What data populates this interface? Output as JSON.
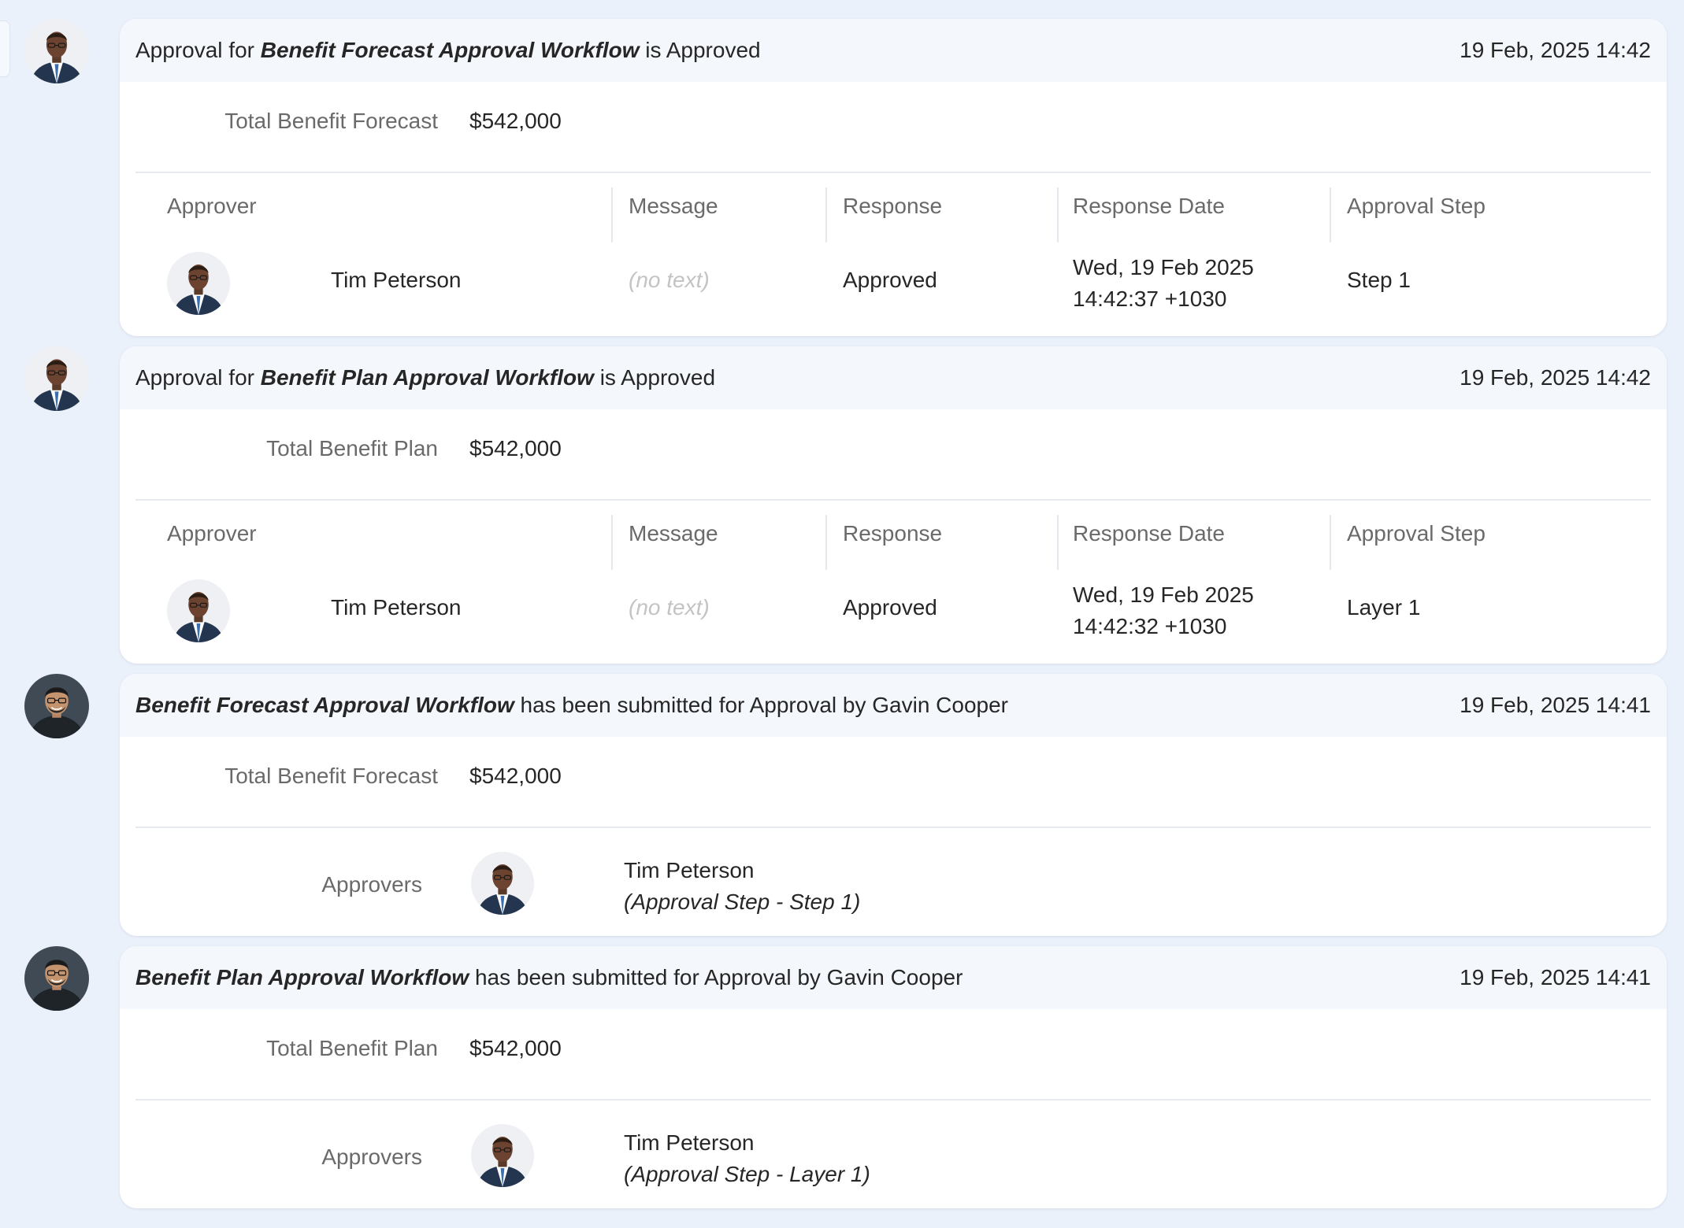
{
  "entries": [
    {
      "actor": "Tim Peterson",
      "header": {
        "prefix": "Approval for ",
        "workflow": "Benefit Forecast Approval Workflow",
        "suffix": " is Approved",
        "timestamp": "19 Feb, 2025 14:42"
      },
      "summary": {
        "label": "Total Benefit Forecast",
        "value": "$542,000"
      },
      "columns": [
        "Approver",
        "Message",
        "Response",
        "Response Date",
        "Approval Step"
      ],
      "row": {
        "approver": "Tim Peterson",
        "message": "(no text)",
        "response": "Approved",
        "date_line1": "Wed, 19 Feb 2025",
        "date_line2": "14:42:37 +1030",
        "step": "Step 1"
      }
    },
    {
      "actor": "Tim Peterson",
      "header": {
        "prefix": "Approval for ",
        "workflow": "Benefit Plan Approval Workflow",
        "suffix": " is Approved",
        "timestamp": "19 Feb, 2025 14:42"
      },
      "summary": {
        "label": "Total Benefit Plan",
        "value": "$542,000"
      },
      "columns": [
        "Approver",
        "Message",
        "Response",
        "Response Date",
        "Approval Step"
      ],
      "row": {
        "approver": "Tim Peterson",
        "message": "(no text)",
        "response": "Approved",
        "date_line1": "Wed, 19 Feb 2025",
        "date_line2": "14:42:32 +1030",
        "step": "Layer 1"
      }
    },
    {
      "actor": "Gavin Cooper",
      "header": {
        "workflow": "Benefit Forecast Approval Workflow",
        "suffix": " has been submitted for Approval by Gavin Cooper",
        "timestamp": "19 Feb, 2025 14:41"
      },
      "summary": {
        "label": "Total Benefit Forecast",
        "value": "$542,000"
      },
      "approvers": {
        "label": "Approvers",
        "name": "Tim Peterson",
        "step": "(Approval Step - Step 1)"
      }
    },
    {
      "actor": "Gavin Cooper",
      "header": {
        "workflow": "Benefit Plan Approval Workflow",
        "suffix": " has been submitted for Approval by Gavin Cooper",
        "timestamp": "19 Feb, 2025 14:41"
      },
      "summary": {
        "label": "Total Benefit Plan",
        "value": "$542,000"
      },
      "approvers": {
        "label": "Approvers",
        "name": "Tim Peterson",
        "step": "(Approval Step - Layer 1)"
      }
    }
  ],
  "colors": {
    "page_background": "#ebf1fa",
    "card_header_background": "#f4f8fd",
    "muted_text": "#6a6a6a",
    "placeholder_text": "#c3c3c3"
  }
}
